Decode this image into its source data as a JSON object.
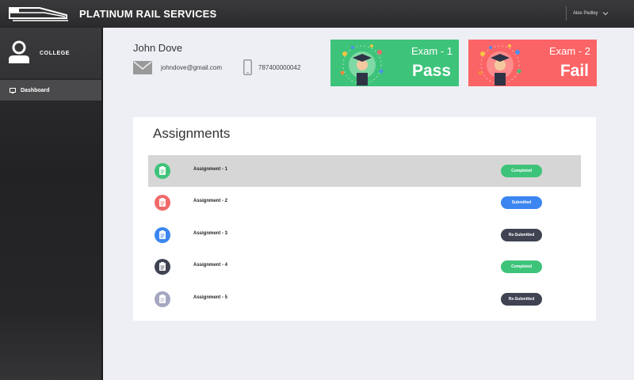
{
  "header": {
    "brand": "PLATINUM RAIL SERVICES",
    "user_name": "Alex Pedley"
  },
  "sidebar": {
    "title": "COLLEGE",
    "items": [
      {
        "label": "Dashboard",
        "icon": "monitor-icon"
      }
    ]
  },
  "profile": {
    "name": "John Dove",
    "email": "johndove@gmail.com",
    "phone": "787400000042"
  },
  "exams": [
    {
      "label": "Exam - 1",
      "result": "Pass",
      "color": "#3ec37a"
    },
    {
      "label": "Exam - 2",
      "result": "Fail",
      "color": "#fb6466"
    }
  ],
  "assignments": {
    "title": "Assignments",
    "rows": [
      {
        "label": "Assignment - 1",
        "status": "Completed",
        "icon_color": "#3ec37a",
        "status_color": "#3ec37a"
      },
      {
        "label": "Assignment - 2",
        "status": "Submitted",
        "icon_color": "#f06a6a",
        "status_color": "#3b86f0"
      },
      {
        "label": "Assignment - 3",
        "status": "Re-Submitted",
        "icon_color": "#3b86f0",
        "status_color": "#3f4352"
      },
      {
        "label": "Assignment - 4",
        "status": "Completed",
        "icon_color": "#3f4352",
        "status_color": "#3ec37a"
      },
      {
        "label": "Assignment - 5",
        "status": "Re-Submitted",
        "icon_color": "#a4a6c2",
        "status_color": "#3f4352"
      }
    ]
  }
}
